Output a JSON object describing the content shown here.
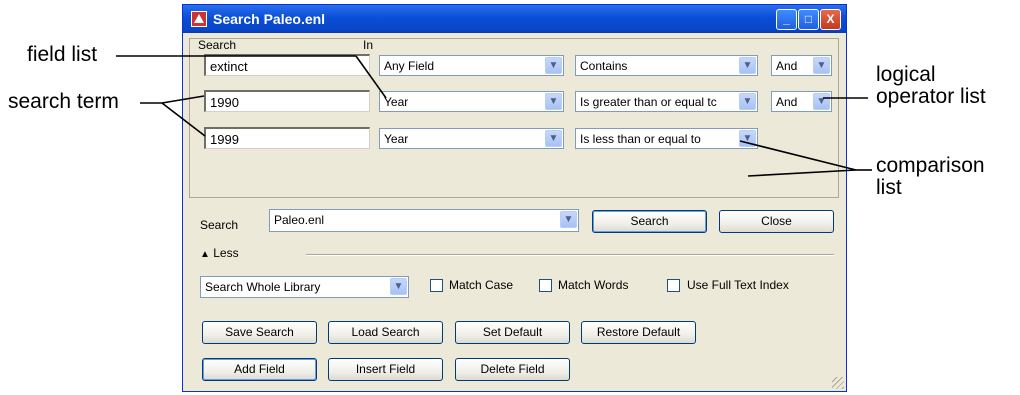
{
  "window": {
    "title": "Search Paleo.enl"
  },
  "title_buttons": {
    "minimize": "_",
    "maximize": "□",
    "close": "X"
  },
  "panel": {
    "search_header": "Search",
    "in_header": "In"
  },
  "rows": [
    {
      "term": "extinct",
      "field": "Any Field",
      "comparison": "Contains",
      "operator": "And"
    },
    {
      "term": "1990",
      "field": "Year",
      "comparison": "Is greater than or equal tc",
      "operator": "And"
    },
    {
      "term": "1999",
      "field": "Year",
      "comparison": "Is less than or equal to"
    }
  ],
  "search_bar": {
    "label": "Search",
    "library": "Paleo.enl",
    "search_button": "Search",
    "close_button": "Close"
  },
  "less_toggle": {
    "label": "Less"
  },
  "scope": {
    "value": "Search Whole Library"
  },
  "options": {
    "match_case": "Match Case",
    "match_words": "Match Words",
    "full_text": "Use Full Text Index"
  },
  "buttons_row1": {
    "save": "Save Search",
    "load": "Load Search",
    "set_default": "Set Default",
    "restore_default": "Restore Default"
  },
  "buttons_row2": {
    "add": "Add Field",
    "insert": "Insert Field",
    "delete": "Delete Field"
  },
  "callouts": {
    "field_list": "field list",
    "search_term": "search term",
    "logical_line1": "logical",
    "logical_line2": "operator list",
    "comparison_line1": "comparison",
    "comparison_line2": "list"
  },
  "icons": {
    "app": "endnote-app-icon",
    "dropdown": "chevron-down-icon",
    "less": "up-arrow-icon"
  }
}
